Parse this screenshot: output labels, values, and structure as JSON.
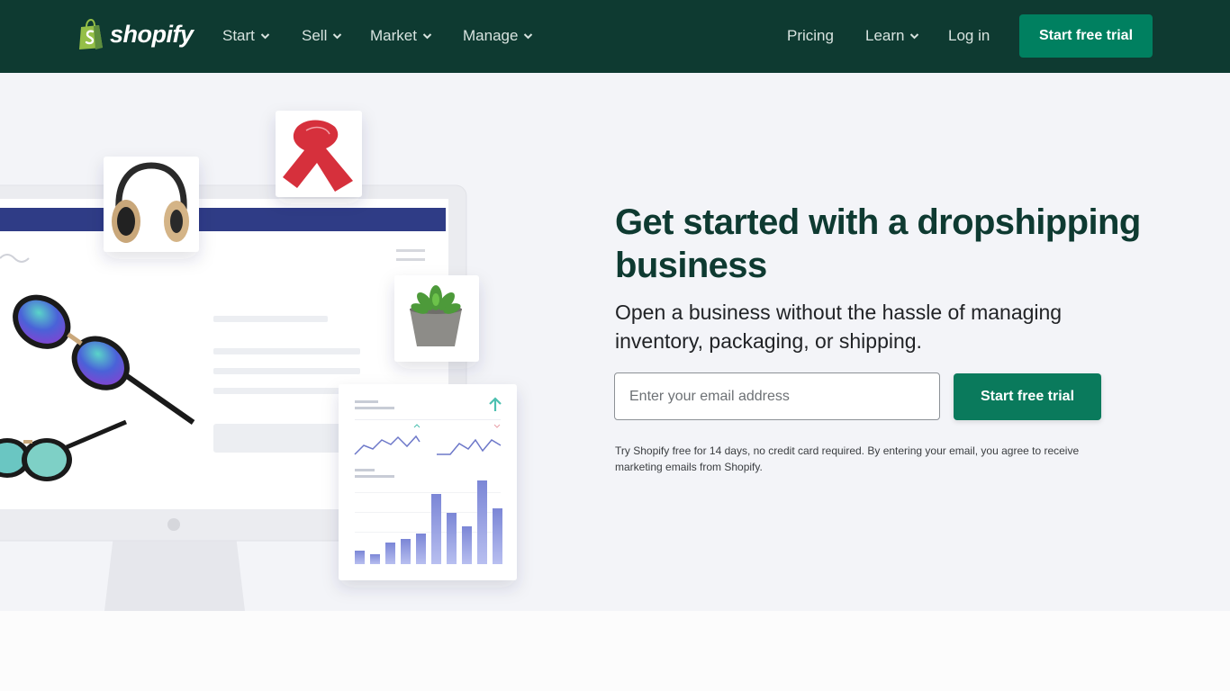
{
  "header": {
    "brand": "shopify",
    "nav": [
      {
        "label": "Start"
      },
      {
        "label": "Sell"
      },
      {
        "label": "Market"
      },
      {
        "label": "Manage"
      }
    ],
    "right_nav": {
      "pricing": "Pricing",
      "learn": "Learn",
      "login": "Log in"
    },
    "cta": "Start free trial"
  },
  "hero": {
    "headline": "Get started with a dropshipping business",
    "subhead": "Open a business without the hassle of managing inventory, packaging, or shipping.",
    "email_placeholder": "Enter your email address",
    "email_value": "",
    "cta": "Start free trial",
    "fineprint": "Try Shopify free for 14 days, no credit card required. By entering your email, you agree to receive marketing emails from Shopify."
  },
  "colors": {
    "header_bg": "#0e3a31",
    "accent": "#008060",
    "hero_bg": "#f3f4f8",
    "headline": "#0e3a31"
  },
  "icons": [
    "shopify-bag-icon",
    "chevron-down-icon"
  ]
}
